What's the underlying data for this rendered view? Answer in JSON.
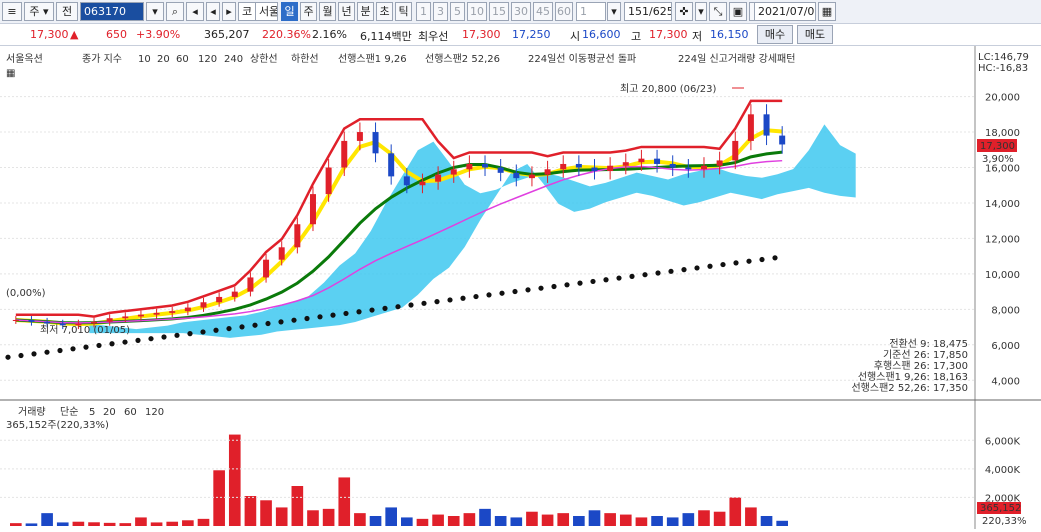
{
  "toolbar": {
    "market_label": "주",
    "type_label": "전",
    "stock_code": "063170",
    "stock_prefix": "코",
    "stock_name": "서울옥션",
    "periods": [
      "일",
      "주",
      "월",
      "년",
      "분",
      "초",
      "틱"
    ],
    "selected_period": "일",
    "intervals": [
      "1",
      "3",
      "5",
      "10",
      "15",
      "30",
      "45",
      "60"
    ],
    "interval_value": "1",
    "page_counter": "151/625",
    "date": "2021/07/01"
  },
  "quote": {
    "price": "17,300",
    "arrow": "▲",
    "change": "650",
    "change_pct": "+3.90%",
    "volume": "365,207",
    "volume_ratio": "220.36%",
    "turnover": "2.16%",
    "amount": "6,114백만",
    "best_label": "최우선",
    "ask": "17,300",
    "bid": "17,250",
    "open_label": "시",
    "open": "16,600",
    "high_label": "고",
    "high": "17,300",
    "low_label": "저",
    "low": "16,150",
    "buy_button": "매수",
    "sell_button": "매도"
  },
  "price_panel": {
    "name": "서울옥션",
    "legend_ma": "종가 지수",
    "ma_periods": [
      "10",
      "20",
      "60",
      "120",
      "240"
    ],
    "ma_colors": [
      "#e040e0",
      "#e8c800",
      "#0a8a0a",
      "#d040d0",
      "#111111"
    ],
    "legend_upper": "상한선",
    "legend_lower": "하한선",
    "legend_span1": "선행스팬1 9,26",
    "legend_span2": "선행스팬2 52,26",
    "legend_signal1": "224일선 이동평균선 돌파",
    "legend_signal2": "224일 신고거래량 강세패턴",
    "lc": "LC:146,79",
    "hc": "HC:-16,83",
    "high_note": "최고 20,800 (06/23)",
    "low_note": "최저 7,010 (01/05)",
    "zero_note": "(0,00%)",
    "price_tag": "17,300",
    "price_tag_pct": "3,90%",
    "y_ticks": [
      "20,000",
      "18,000",
      "16,000",
      "14,000",
      "12,000",
      "10,000",
      "8,000",
      "6,000",
      "4,000"
    ],
    "ichimoku": [
      {
        "label": "전환선 9: 18,475",
        "color": "#1a8a6a"
      },
      {
        "label": "기준선 26: 17,850",
        "color": "#555555"
      },
      {
        "label": "후행스팬 26: 17,300",
        "color": "#a020a0"
      },
      {
        "label": "선행스팬1 9,26: 18,163",
        "color": "#1a8aa0"
      },
      {
        "label": "선행스팬2 52,26: 17,350",
        "color": "#1aa0c0"
      }
    ]
  },
  "volume_panel": {
    "legend_label": "거래량",
    "legend_ma": "단순",
    "ma_periods": [
      "5",
      "20",
      "60",
      "120"
    ],
    "ma_colors": [
      "#e040e0",
      "#e8c800",
      "#0a8a0a",
      "#888888"
    ],
    "current": "365,152주(220,33%)",
    "y_ticks": [
      "6,000K",
      "4,000K",
      "2,000K"
    ],
    "tag_volume": "365,152",
    "tag_pct": "220,33%"
  },
  "chart_data": {
    "type": "candlestick",
    "y_range": [
      3000,
      21500
    ],
    "series_close": [
      7400,
      7300,
      7200,
      7100,
      7200,
      7300,
      7500,
      7600,
      7700,
      7800,
      7900,
      8100,
      8400,
      8700,
      9000,
      9800,
      10800,
      11500,
      12800,
      14500,
      16000,
      17500,
      18000,
      16800,
      15500,
      15000,
      15200,
      15600,
      15900,
      16200,
      16000,
      15700,
      15400,
      15600,
      15900,
      16200,
      16000,
      15800,
      16100,
      16300,
      16500,
      16200,
      16000,
      15900,
      16100,
      16400,
      17500,
      19000,
      17800,
      17300
    ],
    "volume_bars": [
      200,
      180,
      900,
      250,
      300,
      260,
      220,
      200,
      600,
      250,
      300,
      400,
      500,
      3900,
      6400,
      2100,
      1800,
      1300,
      2800,
      1100,
      1200,
      3400,
      900,
      700,
      1300,
      600,
      500,
      800,
      700,
      900,
      1200,
      700,
      600,
      1000,
      800,
      900,
      700,
      1100,
      900,
      800,
      600,
      700,
      600,
      900,
      1100,
      1000,
      2000,
      1300,
      700,
      365
    ]
  }
}
